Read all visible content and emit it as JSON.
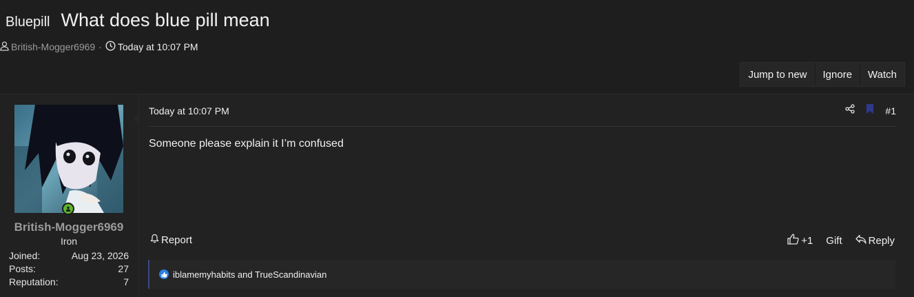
{
  "thread": {
    "prefix": "Bluepill",
    "title": "What does blue pill mean",
    "author": "British-Mogger6969",
    "separator": "·",
    "start_time": "Today at 10:07 PM"
  },
  "thread_actions": [
    "Jump to new",
    "Ignore",
    "Watch"
  ],
  "post": {
    "date": "Today at 10:07 PM",
    "number": "#1",
    "body": "Someone please explain it I’m confused",
    "report_label": "Report",
    "like_count": "+1",
    "gift_label": "Gift",
    "reply_label": "Reply",
    "reactions_text": "iblamemyhabits and TrueScandinavian"
  },
  "user": {
    "name": "British-Mogger6969",
    "role": "Iron",
    "stats": [
      {
        "label": "Joined:",
        "value": "Aug 23, 2026"
      },
      {
        "label": "Posts:",
        "value": "27"
      },
      {
        "label": "Reputation:",
        "value": "7"
      }
    ]
  },
  "colors": {
    "background": "#1e1e1e",
    "online": "#5db52a",
    "bookmark": "#2e3a8c",
    "reaction_like": "#2a7de1",
    "reaction_bar": "#3b4a86"
  }
}
